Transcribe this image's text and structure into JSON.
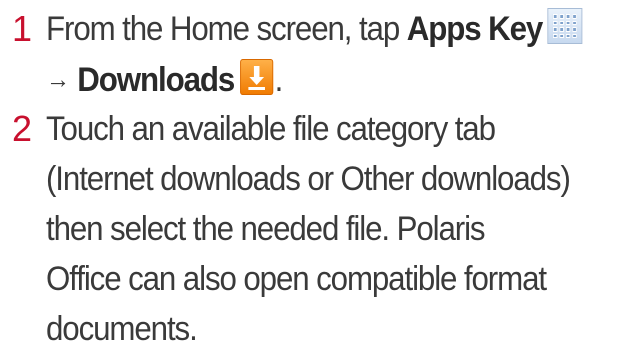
{
  "steps": [
    {
      "number": "1",
      "line1_prefix": "From the Home screen, tap ",
      "line1_bold": "Apps Key",
      "line2_arrow": "→",
      "line2_bold": "Downloads",
      "line2_suffix": ".",
      "icons": [
        "apps-grid-icon",
        "download-icon"
      ]
    },
    {
      "number": "2",
      "lines": [
        "Touch an available file category tab",
        "(Internet downloads or Other downloads)",
        "then select the needed file. Polaris",
        "Office can also open compatible format",
        "documents."
      ]
    }
  ],
  "colors": {
    "step_number": "#c8102e",
    "text": "#3a3a3a",
    "apps_icon": "#7fa2cc",
    "download_icon": "#f07a00"
  }
}
